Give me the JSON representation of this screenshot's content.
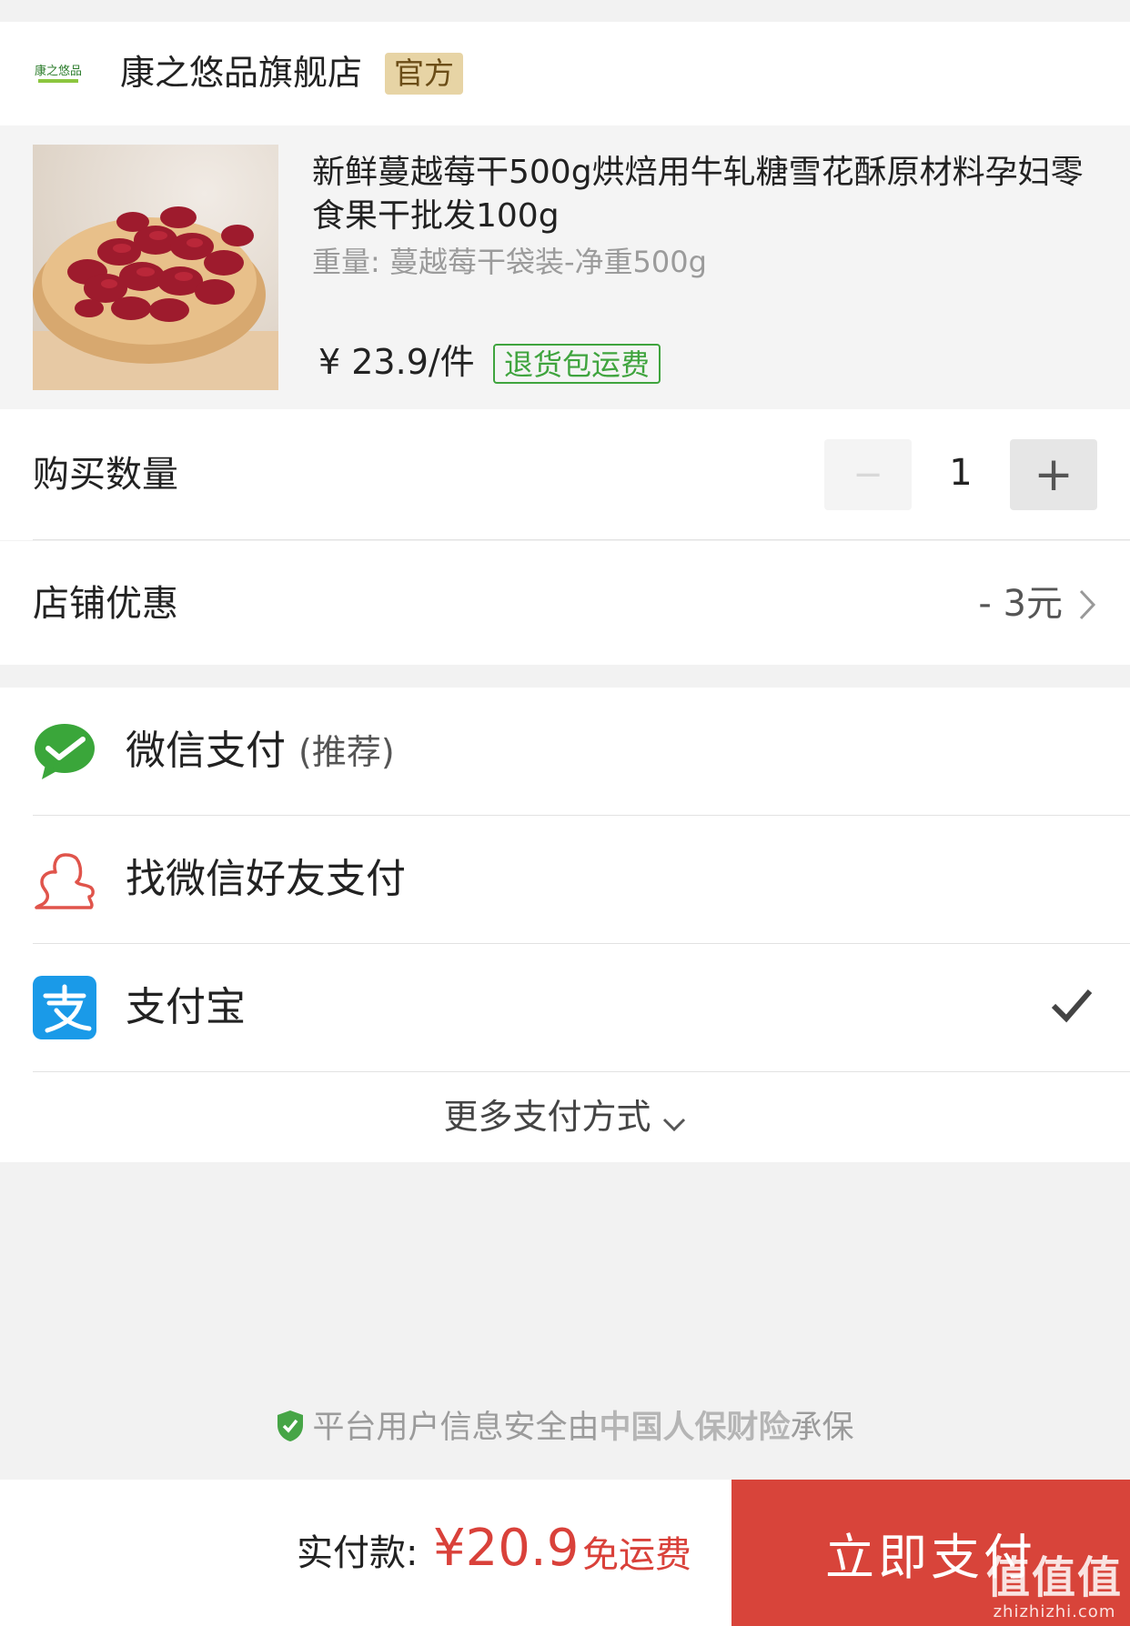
{
  "store": {
    "logo_text": "康之悠品",
    "name": "康之悠品旗舰店",
    "badge": "官方"
  },
  "product": {
    "title": "新鲜蔓越莓干500g烘焙用牛轧糖雪花酥原材料孕妇零食果干批发100g",
    "spec": "重量: 蔓越莓干袋装-净重500g",
    "price": "¥ 23.9/件",
    "return_badge": "退货包运费"
  },
  "quantity": {
    "label": "购买数量",
    "value": "1",
    "minus": "−",
    "plus": "+"
  },
  "discount": {
    "label": "店铺优惠",
    "value": "- 3元"
  },
  "payment": {
    "methods": [
      {
        "label": "微信支付",
        "note": "(推荐)",
        "icon": "wechat-pay-icon",
        "selected": false
      },
      {
        "label": "找微信好友支付",
        "note": "",
        "icon": "friend-pay-icon",
        "selected": false
      },
      {
        "label": "支付宝",
        "note": "",
        "icon": "alipay-icon",
        "selected": true
      }
    ],
    "more_label": "更多支付方式"
  },
  "security": {
    "prefix": "平台用户信息安全由",
    "brand": "中国人保财险",
    "suffix": "承保"
  },
  "checkout": {
    "total_label": "实付款:",
    "total_amount": "¥20.9",
    "shipping": "免运费",
    "pay_button": "立即支付"
  },
  "watermark": {
    "main": "值值值",
    "sub": "zhizhizhi.com"
  },
  "colors": {
    "accent_red": "#d8443a",
    "badge_gold": "#e7d4a5",
    "green": "#3fa43e",
    "alipay_blue": "#1a9ae8"
  }
}
